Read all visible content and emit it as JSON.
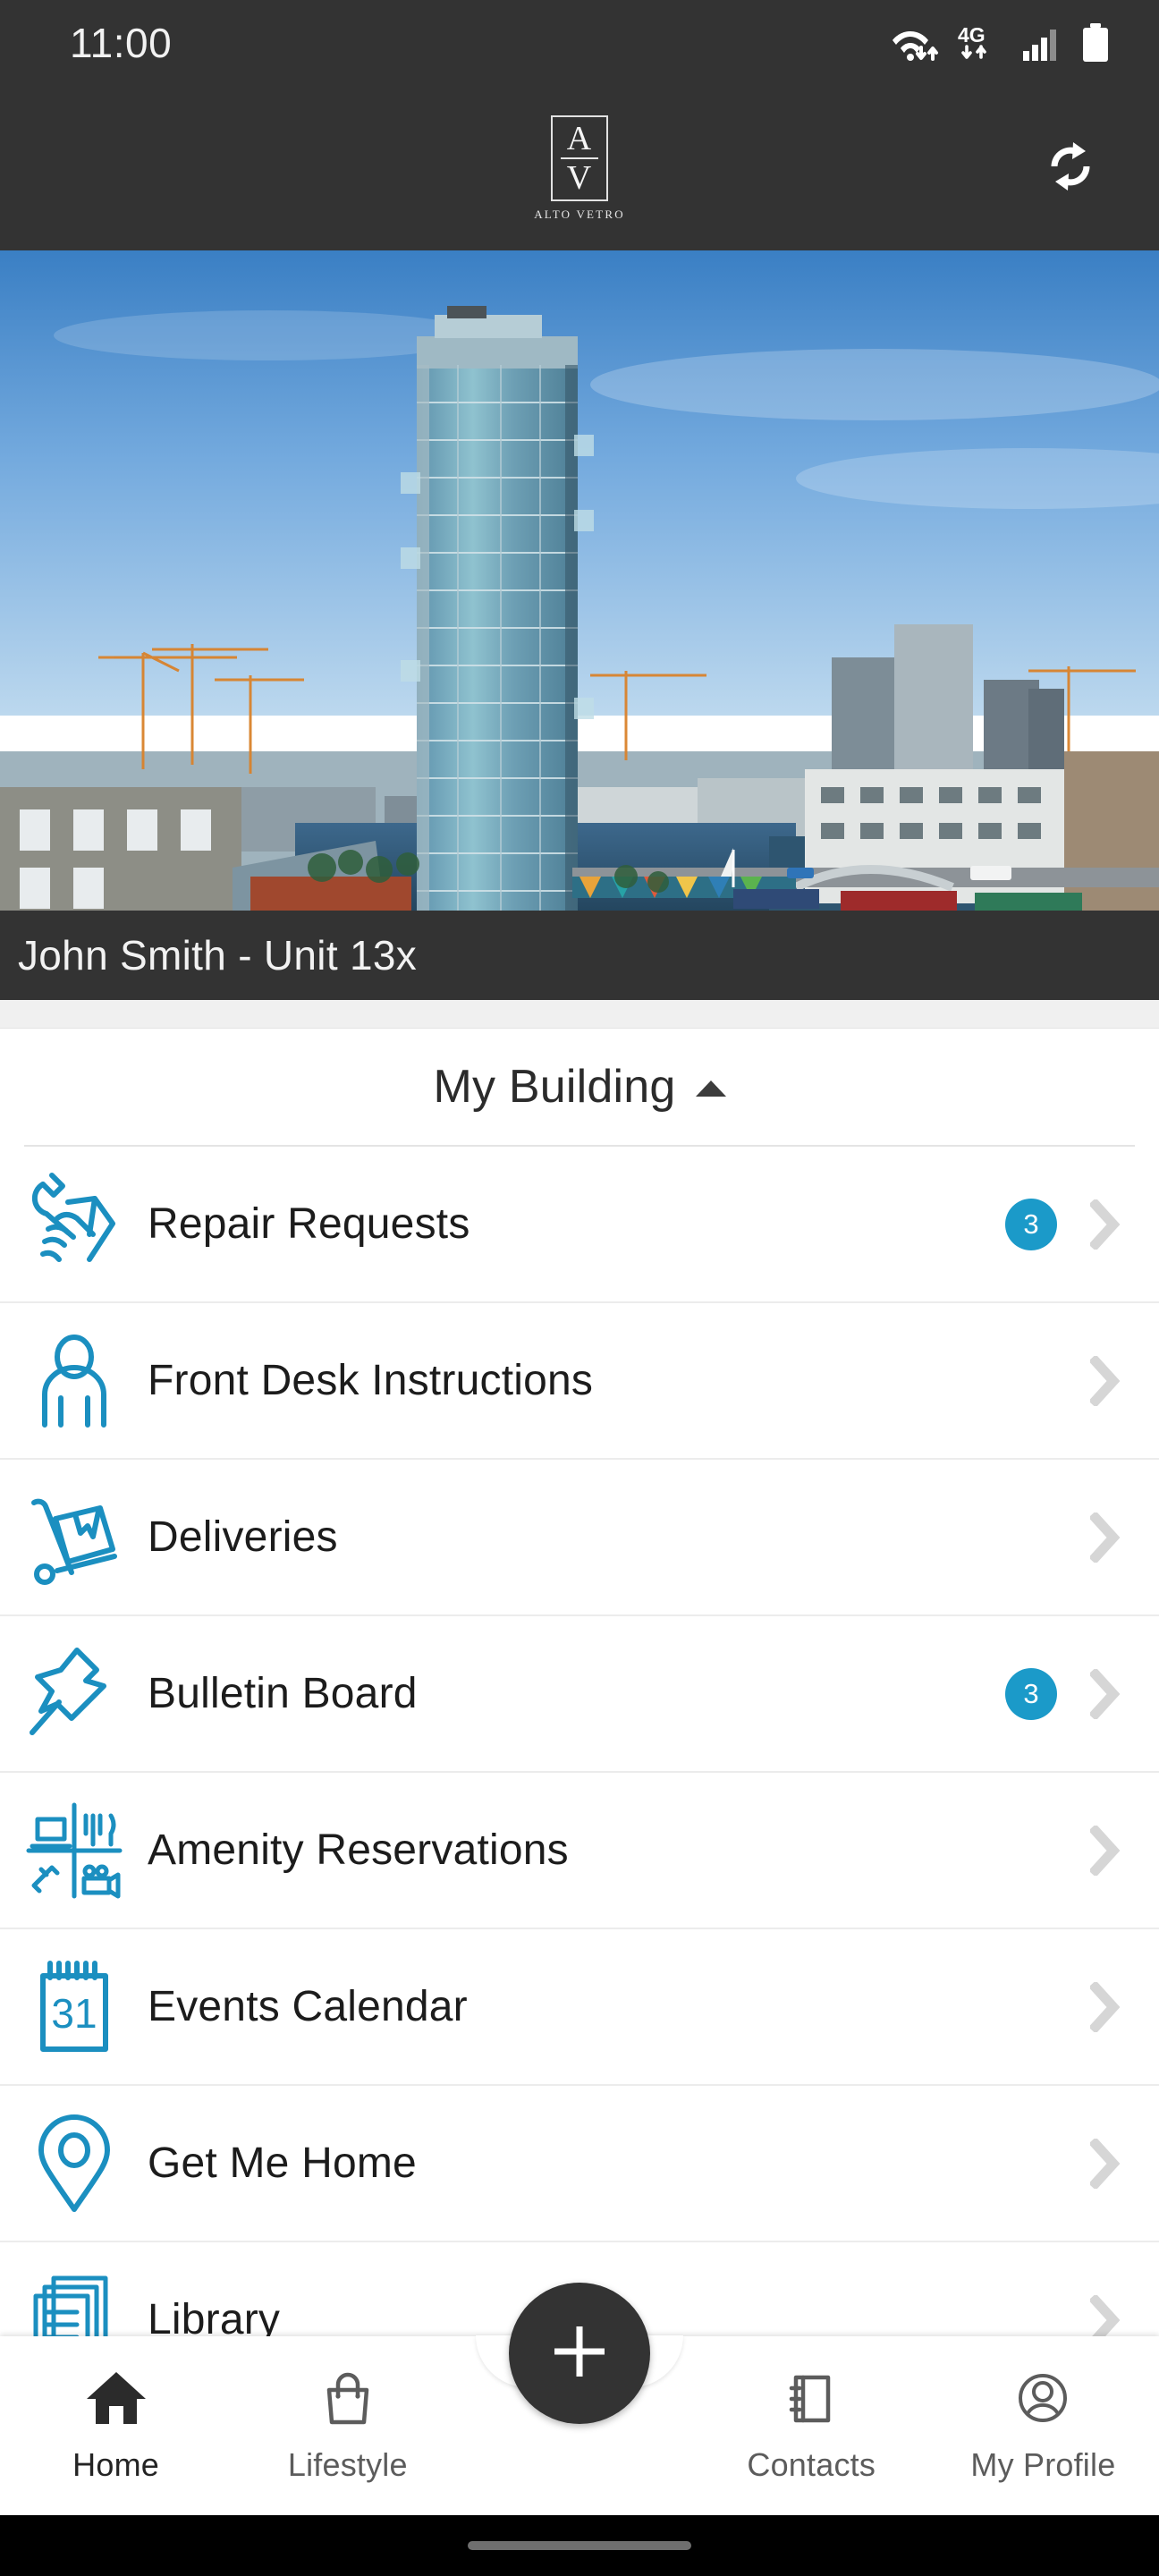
{
  "status_bar": {
    "time": "11:00",
    "icons": [
      "wifi-data-icon",
      "4g-data-icon",
      "signal-bars-icon",
      "battery-icon"
    ],
    "network_label": "4G"
  },
  "app_header": {
    "logo_top_letter": "A",
    "logo_bottom_letter": "V",
    "logo_wordmark": "ALTO VETRO",
    "refresh_icon": "refresh-icon"
  },
  "hero": {
    "alt": "Alto Vetro glass residential tower beside Grand Canal Dock waterfront",
    "user_banner": "John Smith - Unit 13x"
  },
  "section": {
    "title": "My Building",
    "caret_icon": "caret-up-icon",
    "expanded": true
  },
  "menu_items": [
    {
      "label": "Repair Requests",
      "icon": "wrench-hand-icon",
      "badge": "3"
    },
    {
      "label": "Front Desk Instructions",
      "icon": "person-icon",
      "badge": ""
    },
    {
      "label": "Deliveries",
      "icon": "hand-truck-box-icon",
      "badge": ""
    },
    {
      "label": "Bulletin Board",
      "icon": "pushpin-icon",
      "badge": "3"
    },
    {
      "label": "Amenity Reservations",
      "icon": "amenities-grid-icon",
      "badge": ""
    },
    {
      "label": "Events Calendar",
      "icon": "calendar-31-icon",
      "badge": ""
    },
    {
      "label": "Get Me Home",
      "icon": "map-pin-icon",
      "badge": ""
    },
    {
      "label": "Library",
      "icon": "documents-stack-icon",
      "badge": ""
    }
  ],
  "calendar_icon_day": "31",
  "bottom_nav": {
    "items": [
      {
        "label": "Home",
        "icon": "home-icon",
        "active": true
      },
      {
        "label": "Lifestyle",
        "icon": "shopping-bag-icon",
        "active": false
      },
      {
        "label": "Contacts",
        "icon": "address-book-icon",
        "active": false
      },
      {
        "label": "My Profile",
        "icon": "user-circle-icon",
        "active": false
      }
    ],
    "fab_icon": "plus-icon"
  },
  "colors": {
    "header_dark": "#333333",
    "accent_blue": "#1B9AC9",
    "badge_blue": "#1B9AC9",
    "text_primary": "#1C1C1C",
    "chevron_gray": "#D6D6D6",
    "divider_gray": "#ECECEC"
  }
}
